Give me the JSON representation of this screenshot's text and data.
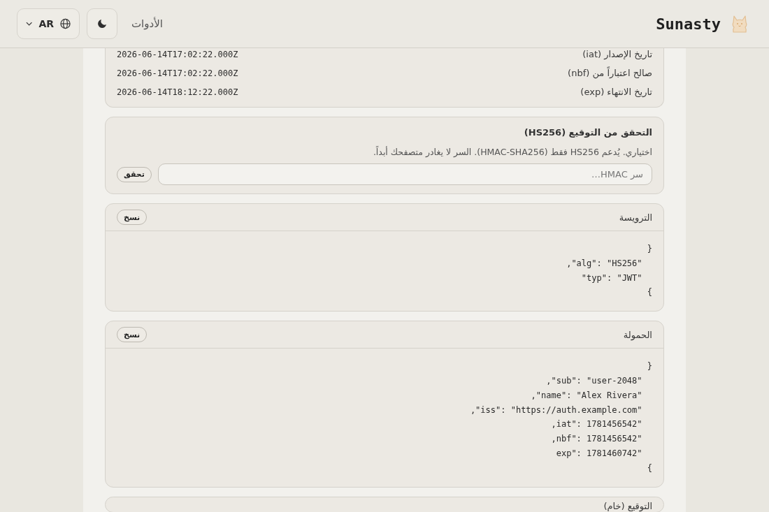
{
  "header": {
    "logo": "Sunasty",
    "nav_link": "الأدوات",
    "language": "AR"
  },
  "claims": [
    {
      "label": "تاريخ الإصدار (iat)",
      "value": "2026-06-14T17:02:22.000Z"
    },
    {
      "label": "صالح اعتباراً من (nbf)",
      "value": "2026-06-14T17:02:22.000Z"
    },
    {
      "label": "تاريخ الانتهاء (exp)",
      "value": "2026-06-14T18:12:22.000Z"
    }
  ],
  "verify": {
    "title": "التحقق من التوقيع (HS256)",
    "description": "اختياري. يُدعم HS256 فقط (HMAC-SHA256). السر لا يغادر متصفحك أبداً.",
    "placeholder": "سر HMAC…",
    "button": "تحقق"
  },
  "sections": [
    {
      "title": "الترويسة",
      "copy_button": "نسخ",
      "lines": [
        "{",
        "  \"alg\": \"HS256\",",
        "  \"typ\": \"JWT\"",
        "}"
      ]
    },
    {
      "title": "الحمولة",
      "copy_button": "نسخ",
      "lines": [
        "{",
        "  \"sub\": \"user-2048\",",
        "  \"name\": \"Alex Rivera\",",
        "  \"iss\": \"https://auth.example.com\",",
        "  \"iat\": 1781456542,",
        "  \"nbf\": 1781456542,",
        "  \"exp\": 1781460742",
        "}"
      ]
    },
    {
      "title": "التوقيع (خام)"
    }
  ]
}
